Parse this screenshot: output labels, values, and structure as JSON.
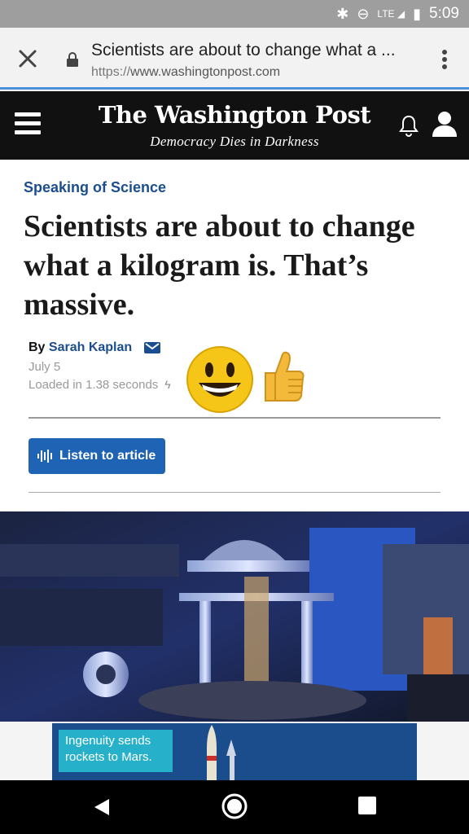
{
  "status_bar": {
    "time": "5:09",
    "network": "LTE"
  },
  "browser": {
    "tab_title": "Scientists are about to change what a ...",
    "url_scheme": "https://",
    "url_host": "www.washingtonpost.com"
  },
  "site_header": {
    "logo": "The Washington Post",
    "tagline": "Democracy Dies in Darkness"
  },
  "article": {
    "kicker": "Speaking of Science",
    "headline": "Scientists are about to change what a kilogram is. That’s massive.",
    "byline_prefix": "By",
    "author": "Sarah Kaplan",
    "date": "July 5",
    "load_time": "Loaded in 1.38 seconds",
    "listen_button": "Listen to article"
  },
  "ad": {
    "text": "Ingenuity sends rockets to Mars."
  },
  "colors": {
    "accent": "#1f64b4",
    "kicker": "#1a4e8f",
    "header_bg": "#111111"
  }
}
